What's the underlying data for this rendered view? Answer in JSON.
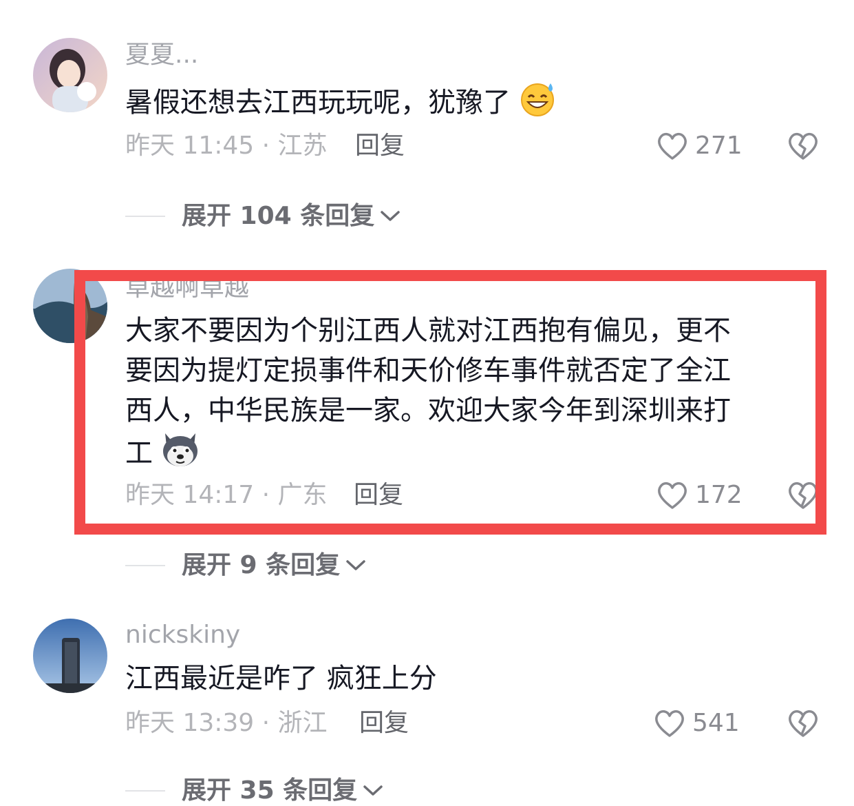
{
  "comments": [
    {
      "username": "夏夏...",
      "text_lines": [
        "暑假还想去江西玩玩呢，犹豫了"
      ],
      "emoji": "grin-sweat-emoji",
      "time": "昨天 11:45 · 江苏",
      "reply_label": "回复",
      "likes": "271",
      "expand_label": "展开 104 条回复"
    },
    {
      "username": "卓越啊卓越",
      "text_lines": [
        "大家不要因为个别江西人就对江西抱有偏见，更不",
        "要因为提灯定损事件和天价修车事件就否定了全江",
        "西人，中华民族是一家。欢迎大家今年到深圳来打",
        "工"
      ],
      "emoji": "husky-emoji",
      "time": "昨天 14:17 · 广东",
      "reply_label": "回复",
      "likes": "172",
      "expand_label": "展开 9 条回复"
    },
    {
      "username": "nickskiny",
      "text_lines": [
        "江西最近是咋了 疯狂上分"
      ],
      "time": "昨天 13:39 · 浙江",
      "reply_label": "回复",
      "likes": "541",
      "expand_label": "展开 35 条回复"
    }
  ],
  "colors": {
    "highlight": "#f24a4a",
    "text": "#161823",
    "meta": "#b3b4b8",
    "username": "#a3a5ab"
  }
}
